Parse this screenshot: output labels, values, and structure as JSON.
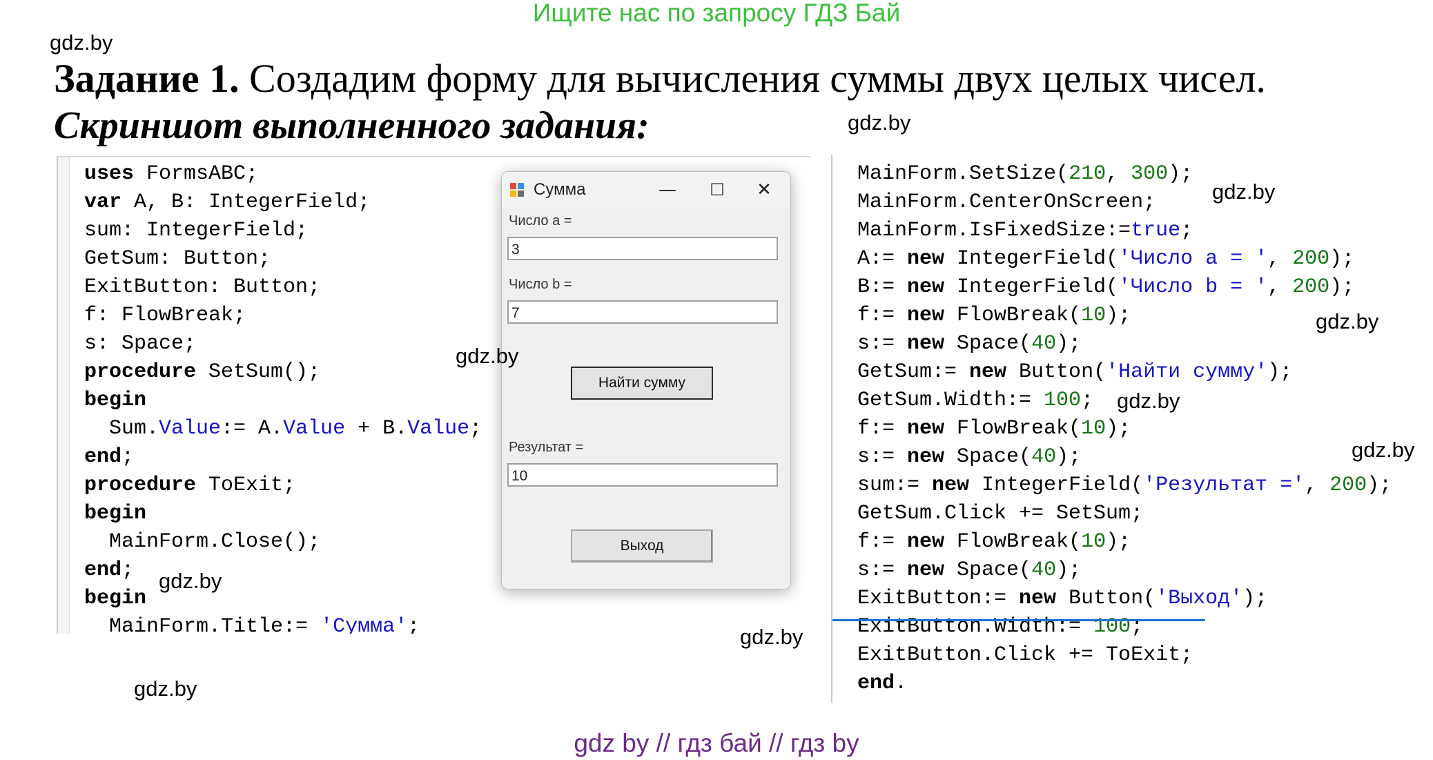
{
  "banner": "Ищите нас по запросу ГДЗ Бай",
  "watermark": "gdz.by",
  "task": {
    "label": "Задание 1.",
    "text": " Создадим форму для вычисления суммы двух целых чисел."
  },
  "subtitle": "Скриншот выполненного задания:",
  "form": {
    "title": "Сумма",
    "minimize": "—",
    "maximize": "☐",
    "close": "✕",
    "label_a": "Число a =",
    "value_a": "3",
    "label_b": "Число b =",
    "value_b": "7",
    "sum_button": "Найти сумму",
    "label_result": "Результат =",
    "value_result": "10",
    "exit_button": "Выход"
  },
  "code_left": [
    "uses FormsABC;",
    "var A, B: IntegerField;",
    "sum: IntegerField;",
    "GetSum: Button;",
    "ExitButton: Button;",
    "f: FlowBreak;",
    "s: Space;",
    "procedure SetSum();",
    "begin",
    "  Sum.Value:= A.Value + B.Value;",
    "end;",
    "procedure ToExit;",
    "begin",
    "  MainForm.Close();",
    "end;",
    "begin",
    "  MainForm.Title:= 'Сумма';"
  ],
  "code_right": [
    "MainForm.SetSize(210, 300);",
    "MainForm.CenterOnScreen;",
    "MainForm.IsFixedSize:=true;",
    "A:= new IntegerField('Число a = ', 200);",
    "B:= new IntegerField('Число b = ', 200);",
    "f:= new FlowBreak(10);",
    "s:= new Space(40);",
    "GetSum:= new Button('Найти сумму');",
    "GetSum.Width:= 100;",
    "f:= new FlowBreak(10);",
    "s:= new Space(40);",
    "sum:= new IntegerField('Результат =', 200);",
    "GetSum.Click += SetSum;",
    "f:= new FlowBreak(10);",
    "s:= new Space(40);",
    "ExitButton:= new Button('Выход');",
    "ExitButton.Width:= 100;",
    "ExitButton.Click += ToExit;",
    "end."
  ],
  "footer": "gdz by  //  гдз бай  //  гдз by"
}
